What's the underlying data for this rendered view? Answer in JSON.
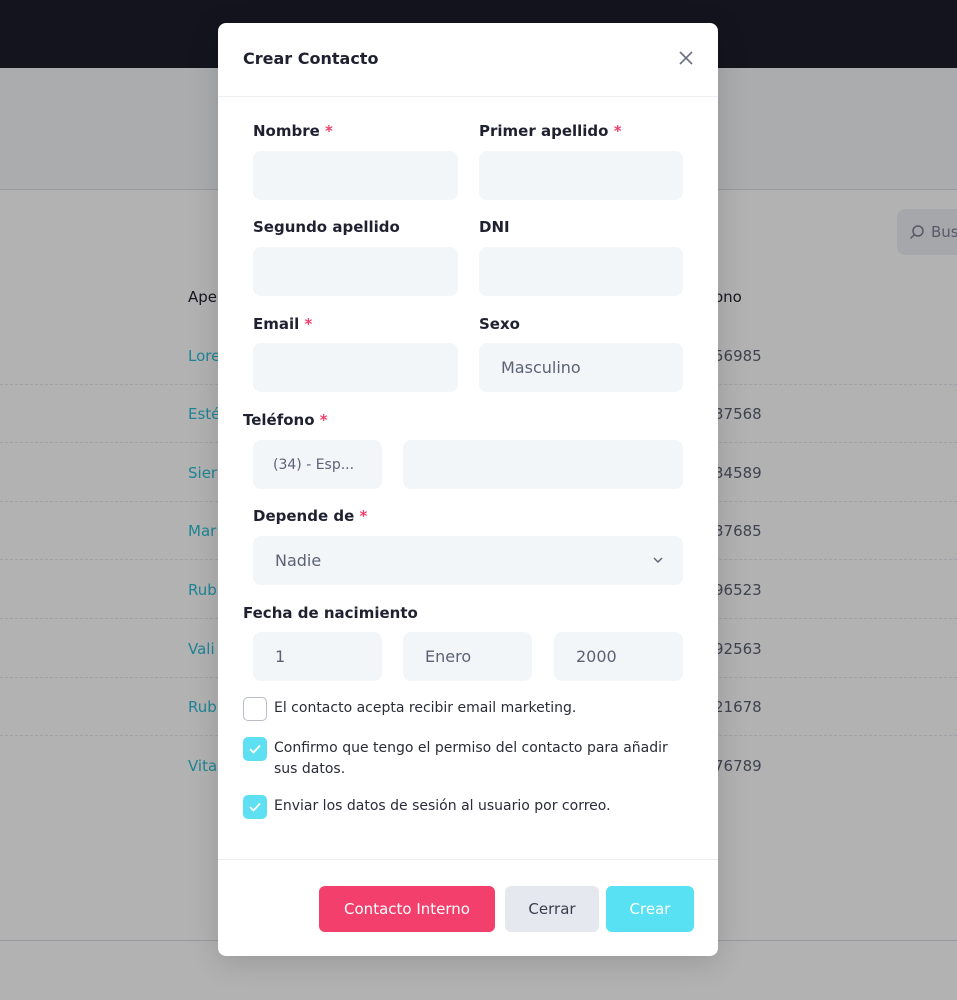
{
  "background": {
    "search_placeholder": "Bus",
    "column_left": "Ape",
    "column_right": "ono",
    "rows": [
      {
        "name": "Lore",
        "phone": "56985"
      },
      {
        "name": "Esté",
        "phone": "37568"
      },
      {
        "name": "Sier",
        "phone": "34589"
      },
      {
        "name": "Mar",
        "phone": "37685"
      },
      {
        "name": "Rub",
        "phone": "96523"
      },
      {
        "name": "Vali",
        "phone": "92563"
      },
      {
        "name": "Rub",
        "phone": "21678"
      },
      {
        "name": "Vita",
        "phone": "76789"
      }
    ]
  },
  "modal": {
    "title": "Crear Contacto",
    "fields": {
      "nombre_label": "Nombre",
      "primer_apellido_label": "Primer apellido",
      "segundo_apellido_label": "Segundo apellido",
      "dni_label": "DNI",
      "email_label": "Email",
      "sexo_label": "Sexo",
      "sexo_value": "Masculino",
      "telefono_label": "Teléfono",
      "telefono_prefix": "(34) - Esp...",
      "depende_label": "Depende de",
      "depende_value": "Nadie",
      "fecha_label": "Fecha de nacimiento",
      "dia": "1",
      "mes": "Enero",
      "anio": "2000",
      "required_mark": "*"
    },
    "checkboxes": [
      {
        "label": "El contacto acepta recibir email marketing.",
        "checked": false
      },
      {
        "label": "Confirmo que tengo el permiso del contacto para añadir sus datos.",
        "checked": true
      },
      {
        "label": "Enviar los datos de sesión al usuario por correo.",
        "checked": true
      }
    ],
    "buttons": {
      "internal": "Contacto Interno",
      "close": "Cerrar",
      "create": "Crear"
    }
  },
  "colors": {
    "topbar": "#1c1d2b",
    "accent_cyan": "#58e1f3",
    "accent_pink": "#f23f6b"
  }
}
